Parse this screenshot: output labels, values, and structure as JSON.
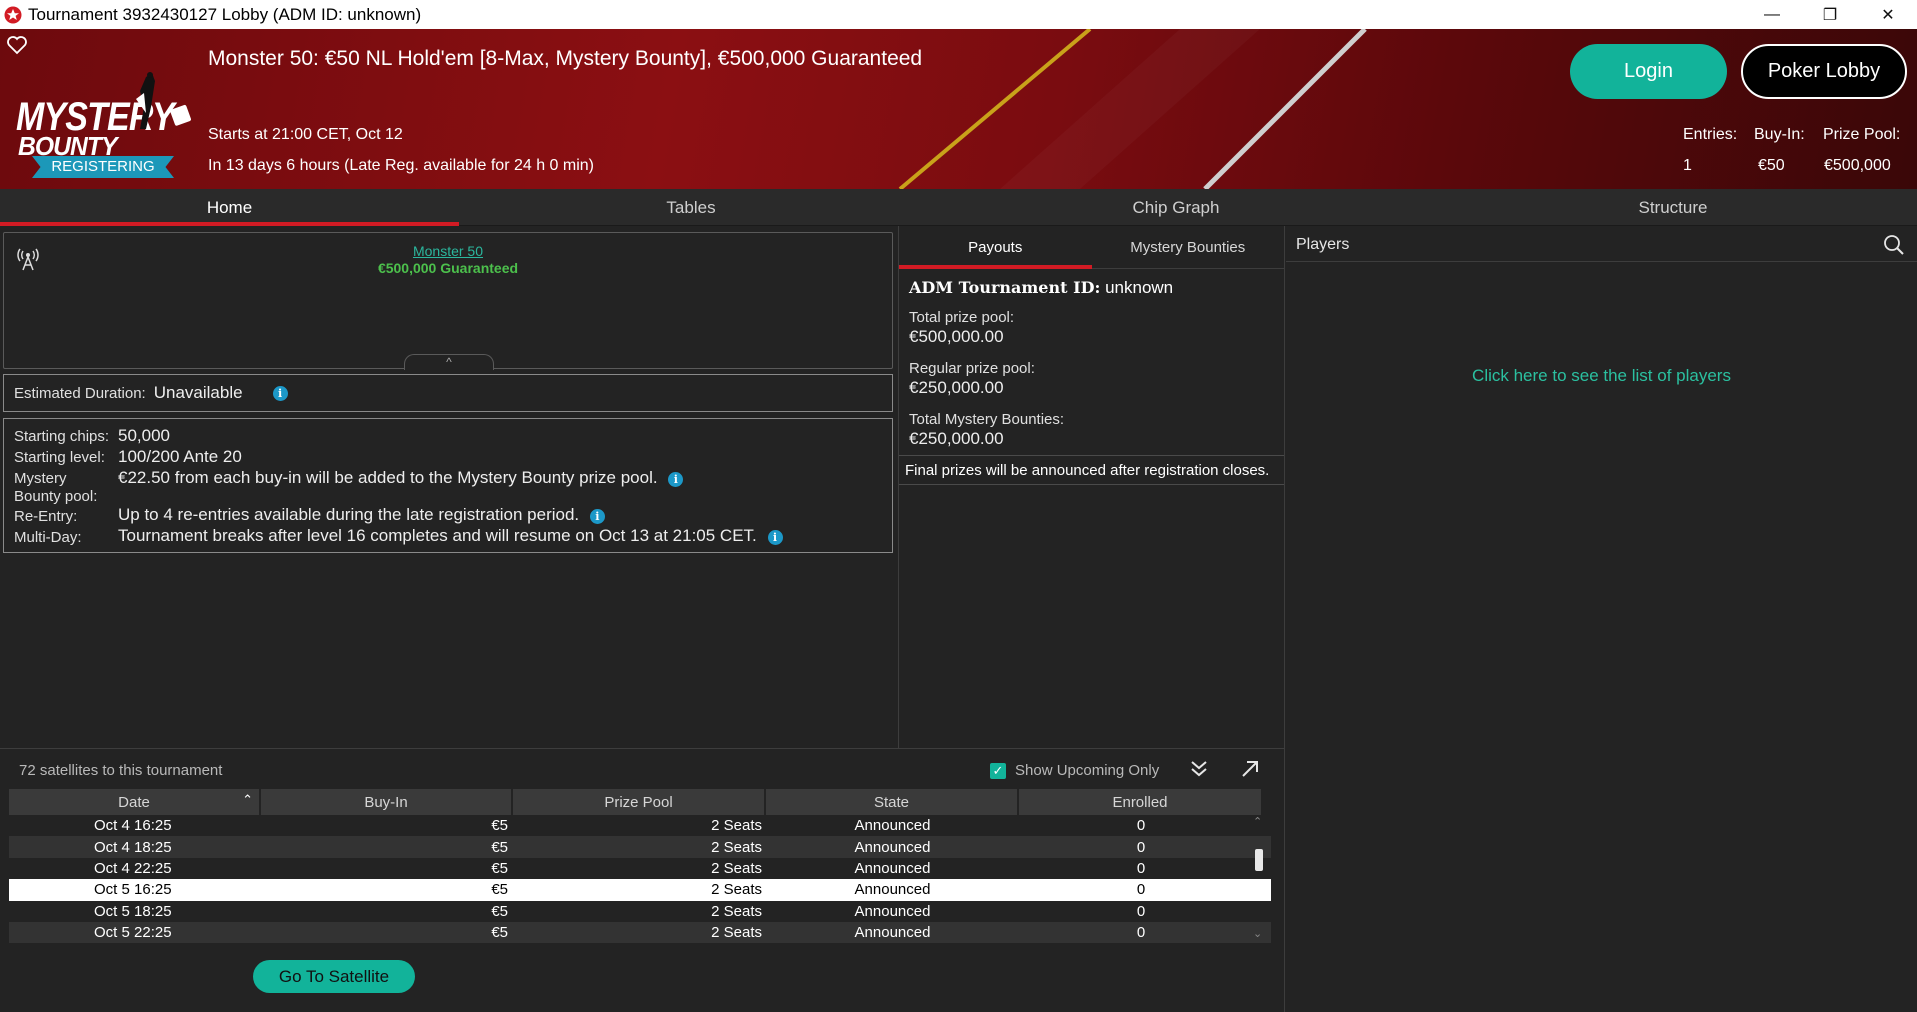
{
  "window": {
    "title": "Tournament 3932430127 Lobby (ADM ID: unknown)"
  },
  "header": {
    "logo_line1": "MYSTERY",
    "logo_line2": "BOUNTY",
    "status_badge": "REGISTERING",
    "tournament_name": "Monster 50: €50 NL Hold'em [8-Max, Mystery Bounty], €500,000 Guaranteed",
    "start_time": "Starts at 21:00 CET, Oct 12",
    "countdown": "In 13 days 6 hours (Late Reg. available for 24 h 0 min)",
    "login_label": "Login",
    "poker_lobby_label": "Poker Lobby",
    "stats": {
      "entries_label": "Entries:",
      "entries_value": "1",
      "buyin_label": "Buy-In:",
      "buyin_value": "€50",
      "prizepool_label": "Prize Pool:",
      "prizepool_value": "€500,000"
    }
  },
  "tabs": [
    {
      "label": "Home",
      "active": true
    },
    {
      "label": "Tables",
      "active": false
    },
    {
      "label": "Chip Graph",
      "active": false
    },
    {
      "label": "Structure",
      "active": false
    }
  ],
  "home": {
    "mini_name": "Monster 50",
    "mini_guarantee": "€500,000 Guaranteed",
    "collapse_glyph": "^",
    "duration_label": "Estimated Duration:",
    "duration_value": "Unavailable",
    "details": [
      {
        "label": "Starting chips:",
        "value": "50,000"
      },
      {
        "label": "Starting level:",
        "value": "100/200 Ante 20"
      },
      {
        "label": "Mystery\nBounty pool:",
        "value": "€22.50 from each buy-in will be added to the Mystery Bounty prize pool."
      },
      {
        "label": "Re-Entry:",
        "value": "Up to 4 re-entries available during the late registration period."
      },
      {
        "label": "Multi-Day:",
        "value": "Tournament breaks after level 16 completes and will resume on Oct 13 at 21:05 CET."
      }
    ]
  },
  "payouts": {
    "tabs": [
      {
        "label": "Payouts",
        "active": true
      },
      {
        "label": "Mystery Bounties",
        "active": false
      }
    ],
    "adm_label": "ADM Tournament ID:",
    "adm_value": "unknown",
    "total_label": "Total prize pool:",
    "total_value": "€500,000.00",
    "regular_label": "Regular prize pool:",
    "regular_value": "€250,000.00",
    "bounties_label": "Total Mystery Bounties:",
    "bounties_value": "€250,000.00",
    "final_note": "Final prizes will be announced after registration closes."
  },
  "players": {
    "title": "Players",
    "link": "Click here to see the list of players"
  },
  "satellites": {
    "count_text": "72 satellites to this tournament",
    "show_upcoming_label": "Show Upcoming Only",
    "show_upcoming_checked": true,
    "columns": [
      "Date",
      "Buy-In",
      "Prize Pool",
      "State",
      "Enrolled"
    ],
    "rows": [
      {
        "date": "Oct 4  16:25",
        "buyin": "€5",
        "pool": "2 Seats",
        "state": "Announced",
        "enrolled": "0"
      },
      {
        "date": "Oct 4  18:25",
        "buyin": "€5",
        "pool": "2 Seats",
        "state": "Announced",
        "enrolled": "0"
      },
      {
        "date": "Oct 4  22:25",
        "buyin": "€5",
        "pool": "2 Seats",
        "state": "Announced",
        "enrolled": "0"
      },
      {
        "date": "Oct 5  16:25",
        "buyin": "€5",
        "pool": "2 Seats",
        "state": "Announced",
        "enrolled": "0"
      },
      {
        "date": "Oct 5  18:25",
        "buyin": "€5",
        "pool": "2 Seats",
        "state": "Announced",
        "enrolled": "0"
      },
      {
        "date": "Oct 5  22:25",
        "buyin": "€5",
        "pool": "2 Seats",
        "state": "Announced",
        "enrolled": "0"
      }
    ],
    "selected_row": 3,
    "go_button": "Go To Satellite"
  },
  "colors": {
    "accent": "#12b39a",
    "tab_active": "#d21b24",
    "badge": "#1c98b9",
    "banner": "#8b0f12"
  }
}
